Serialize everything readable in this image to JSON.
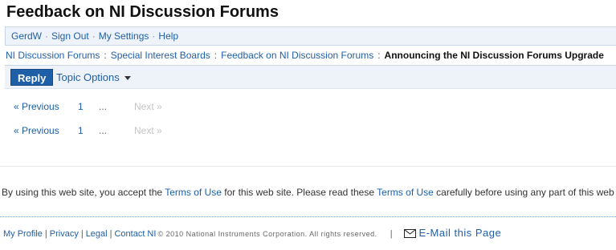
{
  "page": {
    "title": "Feedback on NI Discussion Forums"
  },
  "userbar": {
    "items": [
      "GerdW",
      "Sign Out",
      "My Settings",
      "Help"
    ],
    "separator": "·"
  },
  "breadcrumb": {
    "items": [
      "NI Discussion Forums",
      "Special Interest Boards",
      "Feedback on NI Discussion Forums"
    ],
    "current": "Announcing the NI Discussion Forums Upgrade",
    "separator": ":"
  },
  "actions": {
    "reply_label": "Reply",
    "topic_options_label": "Topic Options"
  },
  "pager": {
    "previous_label": "« Previous",
    "page_label": "1",
    "ellipsis": "...",
    "next_label": "Next »"
  },
  "terms": {
    "prefix": "By using this web site, you accept the ",
    "link1": "Terms of Use",
    "middle": " for this web site. Please read these ",
    "link2": "Terms of Use",
    "suffix": " carefully before using any part of this web site."
  },
  "footer": {
    "my_profile": "My Profile",
    "privacy": "Privacy",
    "legal": "Legal",
    "contact": "Contact NI",
    "separator": "|",
    "copyright": "© 2010 National Instruments Corporation. All rights reserved.",
    "pipe": "|",
    "email_label": "E-Mail this Page"
  },
  "icons": {
    "email": "envelope-icon",
    "topic_options": "caret-down-icon"
  },
  "colors": {
    "link": "#1f5fa8",
    "accent": "#1f5fa8",
    "bar_bg": "#eef3fa"
  }
}
